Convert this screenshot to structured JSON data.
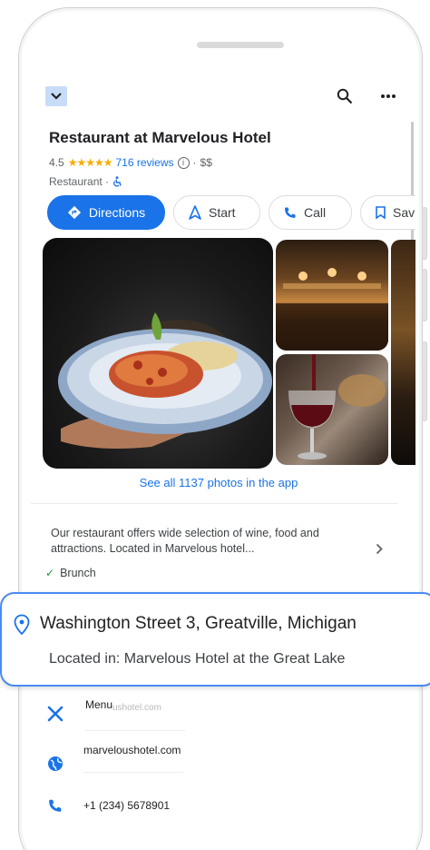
{
  "header": {
    "collapse_icon": "chevron-down-icon",
    "search_icon": "search-icon",
    "more_icon": "more-horizontal-icon"
  },
  "place": {
    "title": "Restaurant at Marvelous Hotel",
    "rating": "4.5",
    "stars": "★★★★★",
    "reviews": "716 reviews",
    "price_separator": "·",
    "price": "$$",
    "category": "Restaurant ·",
    "accessibility_icon": "wheelchair-icon"
  },
  "actions": [
    {
      "label": "Directions",
      "icon": "directions-icon"
    },
    {
      "label": "Start",
      "icon": "navigation-icon"
    },
    {
      "label": "Call",
      "icon": "phone-icon"
    },
    {
      "label": "Sav",
      "icon": "bookmark-icon"
    }
  ],
  "photos": {
    "see_all": "See all 1137 photos in the app"
  },
  "about": {
    "description": "Our restaurant offers wide selection of wine, food and attractions. Located in Marvelous hotel...",
    "tag": "Brunch"
  },
  "address": {
    "line1": "Washington Street 3, Greatville, Michigan",
    "line2": "Located in: Marvelous Hotel at the Great Lake"
  },
  "details": {
    "menu_label": "Menu",
    "menu_ghost": "marvelou",
    "menu_ghost2": "ushotel.com",
    "website": "marvelousho tel.com",
    "website_text": "marvelousho tel.com",
    "website_display": "marvelousho",
    "website_value": "marvelousho",
    "site": "marvelousho tel.com",
    "website_clean": "marvelousho tel.com",
    "url": "marvelousho tel.com",
    "website_shown": "marvelousho tel.com",
    "site_text": "marvelousho tel.com",
    "www": "marvelousho tel.com",
    "web": "marvelousho tel.com",
    "link": "marvelousho tel.com",
    "domain": "marvelousho tel.com",
    "website_final": "marvelousho tel.com",
    "website_label": "marvelousho tel.com",
    "website_row": "marvelousho tel.com",
    "website_visible": "marvelousho tel.com",
    "website_string": "marvelousho tel.com",
    "website_name": "marvelousho tel.com",
    "phone": "+1 (234) 5678901"
  },
  "colors": {
    "accent": "#1a73e8",
    "highlight_border": "#4a8af4",
    "star": "#f9ab00"
  }
}
